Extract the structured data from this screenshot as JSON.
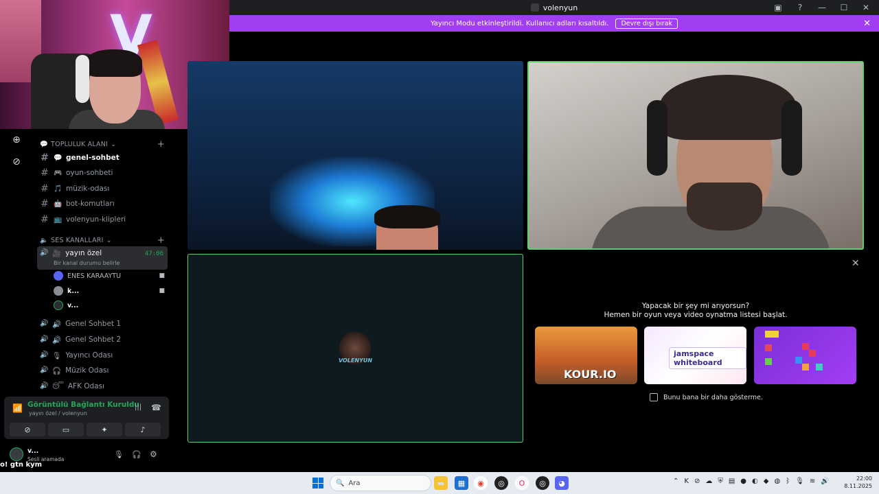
{
  "window": {
    "title": "volenyun"
  },
  "banner": {
    "message": "Yayıncı Modu etkinleştirildi. Kullanıcı adları kısaltıldı.",
    "button": "Devre dışı bırak"
  },
  "sidebar": {
    "category_text": "TOPLULUK ALANI",
    "text_channels": [
      {
        "emoji": "💬",
        "name": "genel-sohbet",
        "active": true
      },
      {
        "emoji": "🎮",
        "name": "oyun-sohbeti"
      },
      {
        "emoji": "🎵",
        "name": "müzik-odası"
      },
      {
        "emoji": "🤖",
        "name": "bot-komutları"
      },
      {
        "emoji": "📺",
        "name": "volenyun-klipleri"
      }
    ],
    "category_voice": "SES KANALLARI",
    "selected_voice": {
      "emoji": "🎥",
      "name": "yayın özel",
      "timer": "47:06",
      "status": "Bir kanal durumu belirle"
    },
    "members": [
      {
        "name": "ENES KARAAYTU",
        "camera": true
      },
      {
        "name": "k...",
        "camera": true
      },
      {
        "name": "v...",
        "camera": false
      }
    ],
    "voice_channels": [
      {
        "emoji": "🔊",
        "name": "Genel Sohbet 1"
      },
      {
        "emoji": "🔊",
        "name": "Genel Sohbet 2"
      },
      {
        "emoji": "🎙",
        "name": "Yayıncı Odası"
      },
      {
        "emoji": "🎧",
        "name": "Müzik Odası"
      },
      {
        "emoji": "😴",
        "name": "AFK Odası"
      }
    ]
  },
  "voice_panel": {
    "status": "Görüntülü Bağlantı Kuruldu",
    "location": "yayın özel / volenyun"
  },
  "user": {
    "name": "v...",
    "status": "Sesli aramada"
  },
  "caption": "o! gtn kym",
  "stage": {
    "tile3_logo_text": "VOLENYUN"
  },
  "activity": {
    "line1": "Yapacak bir şey mi arıyorsun?",
    "line2": "Hemen bir oyun veya video oynatma listesi başlat.",
    "cards": [
      "KOUR.IO",
      "jamspace whiteboard",
      "Blocks"
    ],
    "checkbox_label": "Bunu bana bir daha gösterme."
  },
  "taskbar": {
    "search_placeholder": "Ara",
    "time": "22:00",
    "date": "8.11.2025"
  },
  "colors": {
    "accent_green": "#23a559",
    "banner_purple": "#a13ef0",
    "tile_border": "#5fd06b"
  }
}
